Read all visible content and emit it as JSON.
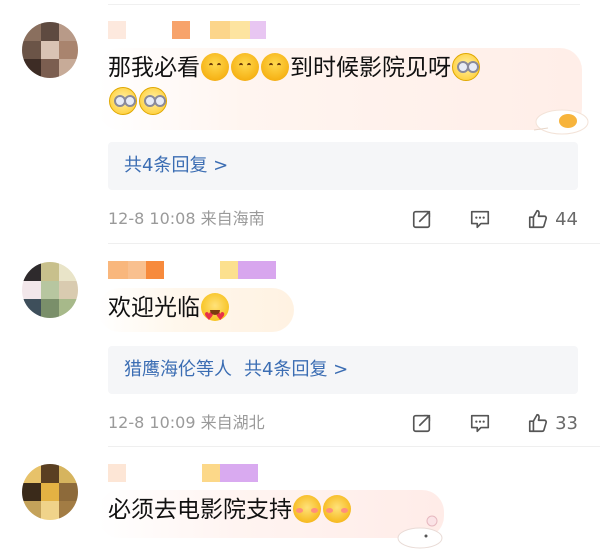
{
  "comments": [
    {
      "text_before": "那我必看",
      "text_middle": "到时候影院见呀",
      "replies_label": "共4条回复 >",
      "time": "12-8 10:08",
      "location": "来自海南",
      "likes": "44",
      "emojis": [
        "hug-emoji",
        "hug-emoji",
        "hug-emoji",
        "dizzy-emoji",
        "dizzy-emoji",
        "dizzy-emoji"
      ]
    },
    {
      "text": "欢迎光临",
      "replies_who": "猎鹰海伦等人",
      "replies_label": "共4条回复 >",
      "time": "12-8 10:09",
      "location": "来自湖北",
      "likes": "33",
      "emojis": [
        "heart-eyes-emoji"
      ]
    },
    {
      "text": "必须去电影院支持",
      "emojis": [
        "blush-emoji",
        "blush-emoji"
      ]
    }
  ],
  "icons": {
    "share": "share-icon",
    "comment": "comment-icon",
    "like": "thumbs-up-icon"
  },
  "colors": {
    "link": "#3b6db3",
    "meta": "#9a9a9a",
    "reply_bg": "#f5f6f8"
  }
}
